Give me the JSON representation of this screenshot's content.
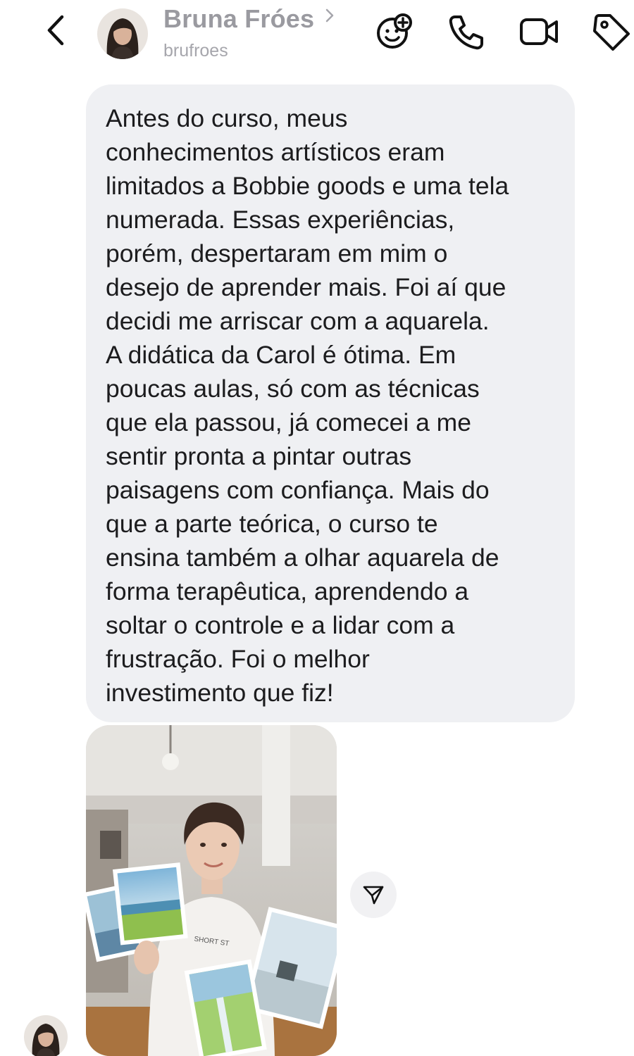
{
  "header": {
    "contact_name": "Bruna Fróes",
    "username": "brufroes",
    "icons": [
      "back-arrow-icon",
      "avatar",
      "chevron-right-icon",
      "add-effect-icon",
      "phone-icon",
      "video-camera-icon",
      "tag-icon"
    ]
  },
  "message": {
    "text": "Antes do curso, meus\nconhecimentos artísticos eram\nlimitados a Bobbie goods e uma tela\nnumerada. Essas experiências,\nporém, despertaram em mim o\ndesejo de aprender mais. Foi aí que\ndecidi me arriscar com a aquarela.\nA didática da Carol é ótima. Em\npoucas aulas, só com as técnicas\nque ela passou, já comecei a me\nsentir pronta a pintar outras\npaisagens com confiança. Mais do\nque a parte teórica, o curso te\nensina também a olhar  aquarela de\nforma terapêutica, aprendendo a\nsoltar o controle e a lidar com a\nfrustração. Foi o melhor\ninvestimento que fiz!"
  },
  "photo": {
    "shirt_text": "SHORT ST"
  },
  "colors": {
    "bubble_bg": "#eff0f3",
    "header_name": "#9a9aa0",
    "icon_stroke": "#111111"
  }
}
